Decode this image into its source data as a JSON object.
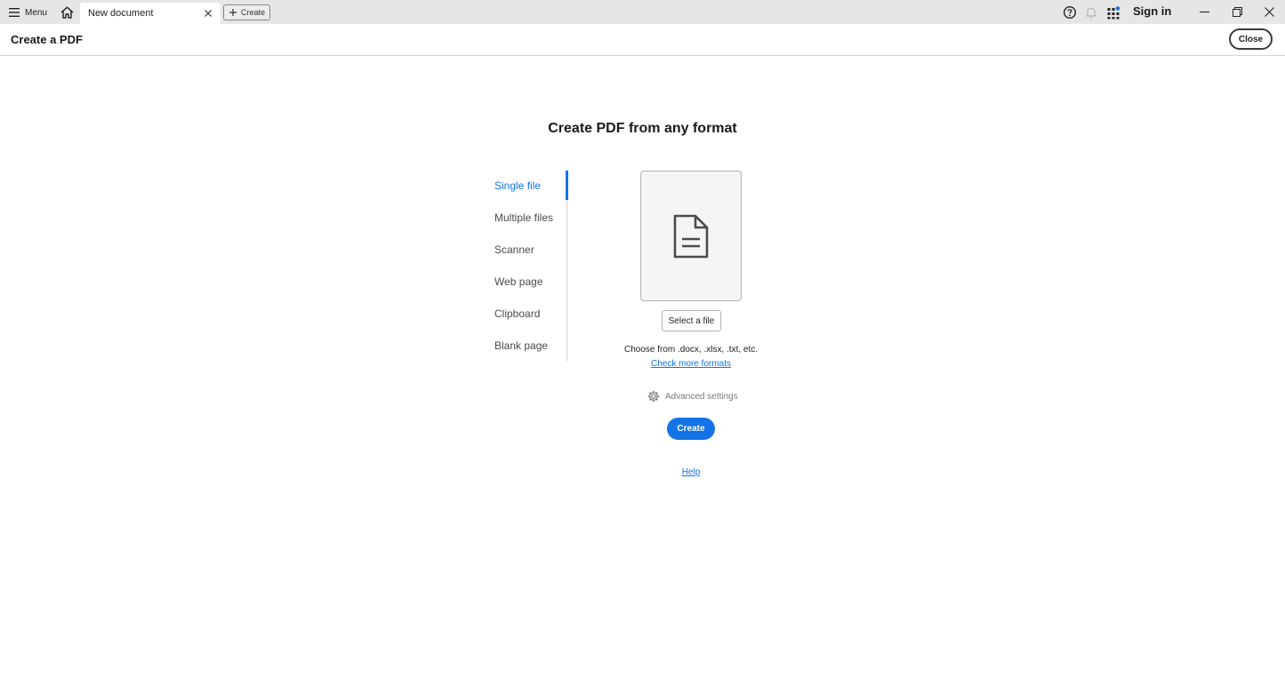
{
  "titlebar": {
    "menu_label": "Menu",
    "tab_title": "New document",
    "new_tab_label": "Create",
    "sign_in_label": "Sign in"
  },
  "header": {
    "title": "Create a PDF",
    "close_label": "Close"
  },
  "main": {
    "heading": "Create PDF from any format",
    "nav_items": [
      {
        "label": "Single file",
        "active": true
      },
      {
        "label": "Multiple files",
        "active": false
      },
      {
        "label": "Scanner",
        "active": false
      },
      {
        "label": "Web page",
        "active": false
      },
      {
        "label": "Clipboard",
        "active": false
      },
      {
        "label": "Blank page",
        "active": false
      }
    ],
    "select_file_label": "Select a file",
    "formats_text": "Choose from .docx, .xlsx, .txt, etc.",
    "formats_link": "Check more formats",
    "advanced_settings_label": "Advanced settings",
    "create_label": "Create",
    "help_link": "Help"
  },
  "icons": {
    "menu": "hamburger-icon",
    "home": "home-icon",
    "tab_close": "close-icon",
    "new_tab": "plus-icon",
    "help": "question-circle-icon",
    "notifications": "bell-icon",
    "apps": "apps-grid-icon",
    "minimize": "minimize-icon",
    "restore": "restore-icon",
    "window_close": "close-icon",
    "file": "document-icon",
    "settings": "gear-icon"
  },
  "colors": {
    "accent": "#1473e6",
    "titlebar_bg": "#e6e6e6",
    "notification_dot": "#1473e6"
  }
}
